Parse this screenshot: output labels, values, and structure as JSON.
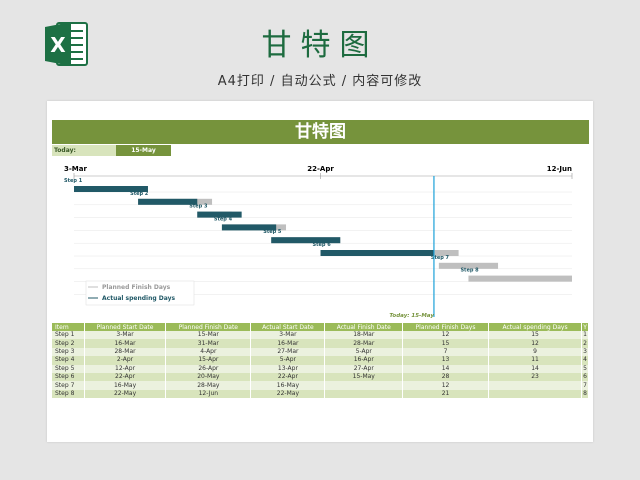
{
  "banner": {
    "title": "甘特图",
    "subtitle": "A4打印 / 自动公式 / 内容可修改",
    "logo_letter": "X",
    "logo_color": "#1d7044"
  },
  "sheet": {
    "title": "甘特图",
    "today_label": "Today:",
    "today_value": "15-May"
  },
  "chart_data": {
    "type": "bar",
    "orientation": "horizontal-gantt",
    "x_ticks": [
      "3-Mar",
      "22-Apr",
      "12-Jun"
    ],
    "x_range": [
      "3-Mar",
      "12-Jun"
    ],
    "today": "15-May",
    "today_annotation": "Today: 15-May",
    "categories": [
      "Step 1",
      "Step 2",
      "Step 3",
      "Step 4",
      "Step 5",
      "Step 6",
      "Step 7",
      "Step 8"
    ],
    "start": [
      "3-Mar",
      "16-Mar",
      "28-Mar",
      "2-Apr",
      "12-Apr",
      "22-Apr",
      "16-May",
      "22-May"
    ],
    "series": [
      {
        "name": "Planned Finish Days",
        "values": [
          15,
          15,
          7,
          13,
          14,
          28,
          12,
          21
        ],
        "color": "#bfbfbf"
      },
      {
        "name": "Actual spending Days",
        "values": [
          15,
          12,
          9,
          11,
          14,
          23,
          0,
          0
        ],
        "color": "#215967"
      }
    ],
    "legend_position": "bottom-left",
    "grid": true
  },
  "table": {
    "headers": [
      "Item",
      "Planned Start Date",
      "Planned Finish Date",
      "Actual Start Date",
      "Actual Finish Date",
      "Planned Finish Days",
      "Actual spending Days",
      "Y"
    ],
    "rows": [
      [
        "Step 1",
        "3-Mar",
        "15-Mar",
        "3-Mar",
        "18-Mar",
        "12",
        "15",
        "1"
      ],
      [
        "Step 2",
        "16-Mar",
        "31-Mar",
        "16-Mar",
        "28-Mar",
        "15",
        "12",
        "2"
      ],
      [
        "Step 3",
        "28-Mar",
        "4-Apr",
        "27-Mar",
        "5-Apr",
        "7",
        "9",
        "3"
      ],
      [
        "Step 4",
        "2-Apr",
        "15-Apr",
        "5-Apr",
        "16-Apr",
        "13",
        "11",
        "4"
      ],
      [
        "Step 5",
        "12-Apr",
        "26-Apr",
        "13-Apr",
        "27-Apr",
        "14",
        "14",
        "5"
      ],
      [
        "Step 6",
        "22-Apr",
        "20-May",
        "22-Apr",
        "15-May",
        "28",
        "23",
        "6"
      ],
      [
        "Step 7",
        "16-May",
        "28-May",
        "16-May",
        "",
        "12",
        "",
        "7"
      ],
      [
        "Step 8",
        "22-May",
        "12-Jun",
        "22-May",
        "",
        "21",
        "",
        "8"
      ]
    ]
  }
}
